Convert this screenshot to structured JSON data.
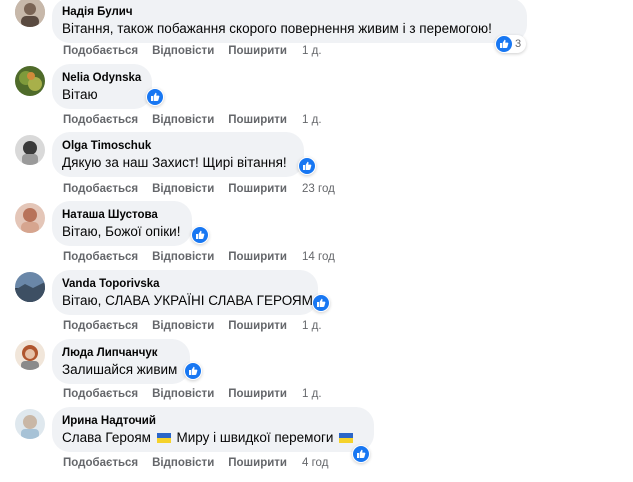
{
  "actions": {
    "like": "Подобається",
    "reply": "Відповісти",
    "share": "Поширити"
  },
  "comments": [
    {
      "author": "Надія Булич",
      "text": "Вітання, також побажання скорого повернення живим і з перемогою!",
      "time": "1 д.",
      "reactions": "3"
    },
    {
      "author": "Nelia Odynska",
      "text": "Вітаю",
      "time": "1 д."
    },
    {
      "author": "Olga Timoschuk",
      "text": "Дякую за наш Захист! Щирі вітання!",
      "time": "23 год"
    },
    {
      "author": "Наташа Шустова",
      "text": "Вітаю, Божої опіки!",
      "time": "14 год"
    },
    {
      "author": "Vanda Toporivska",
      "text": "Вітаю, СЛАВА УКРАЇНІ СЛАВА ГЕРОЯМ",
      "time": "1 д."
    },
    {
      "author": "Люда Липчанчук",
      "text": "Залишайся живим",
      "time": "1 д."
    },
    {
      "author": "Ирина Надточий",
      "text_parts": [
        "Слава Героям",
        "Миру і швидкої перемоги"
      ],
      "time": "4 год"
    }
  ],
  "colors": {
    "bubble": "#f0f2f5",
    "accent": "#1877f2",
    "muted": "#65676b"
  }
}
